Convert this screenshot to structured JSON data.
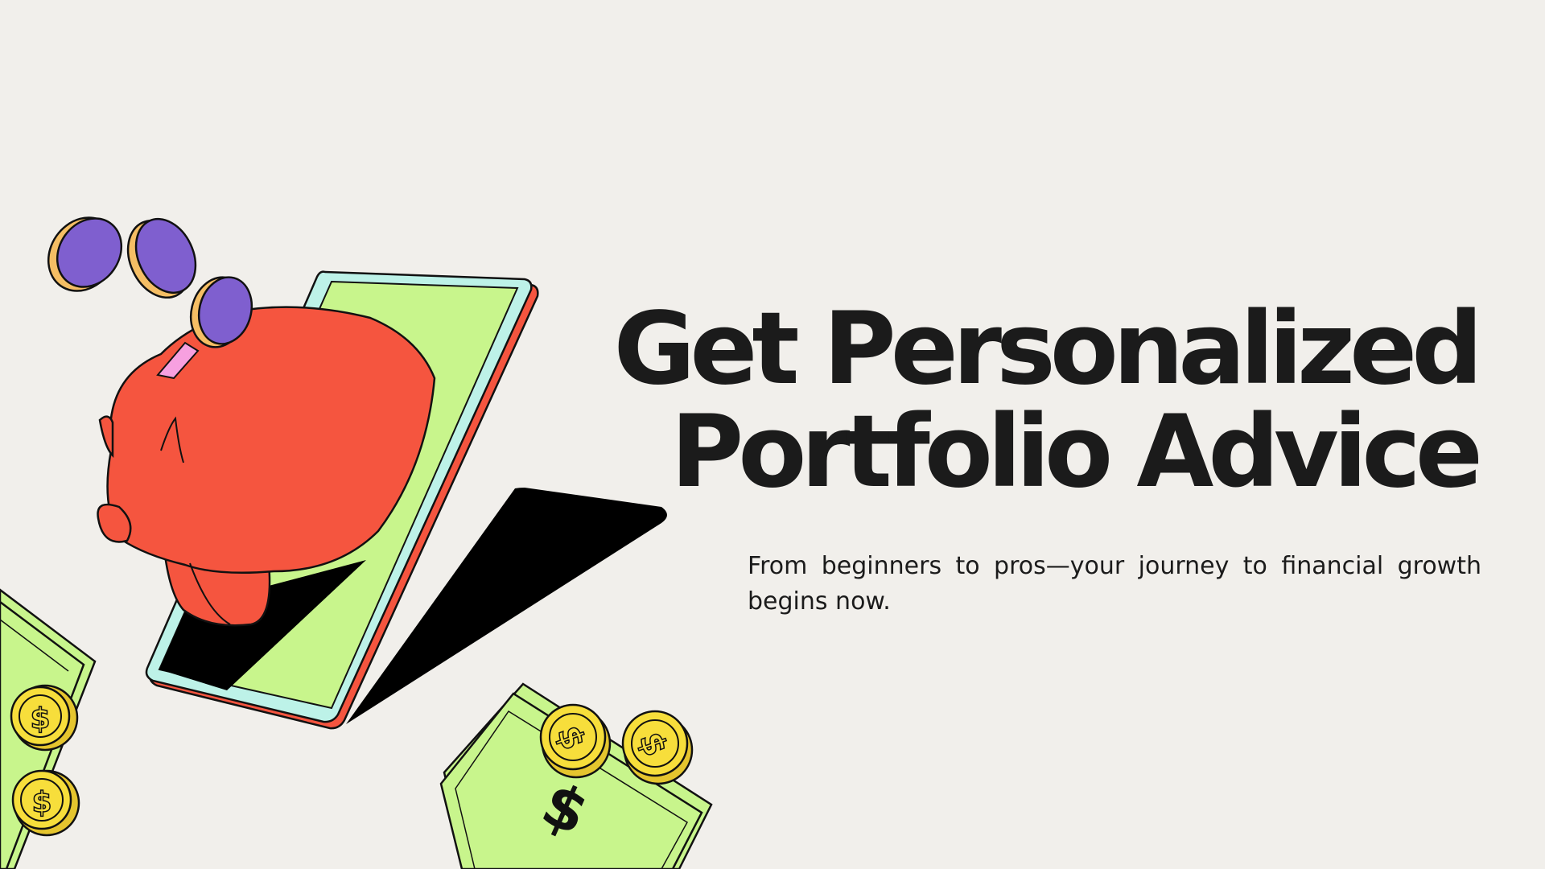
{
  "headline": {
    "line1": "Get Personalized",
    "line2": "Portfolio Advice"
  },
  "subtitle": "From beginners to pros—your journey to financial growth begins now.",
  "illustration": {
    "icons": [
      "piggy-bank-icon",
      "phone-icon",
      "coin-icon",
      "banknote-icon",
      "dollar-coin-icon"
    ]
  },
  "colors": {
    "background": "#f1efeb",
    "text": "#1b1b1b",
    "pig": "#f5553f",
    "screen": "#c8f58c",
    "coin_face": "#7f5fcf",
    "coin_edge": "#f5be64",
    "gold_coin": "#f7de3b",
    "banknote": "#c8f58c",
    "phone_frame": "#bdf2e8"
  }
}
